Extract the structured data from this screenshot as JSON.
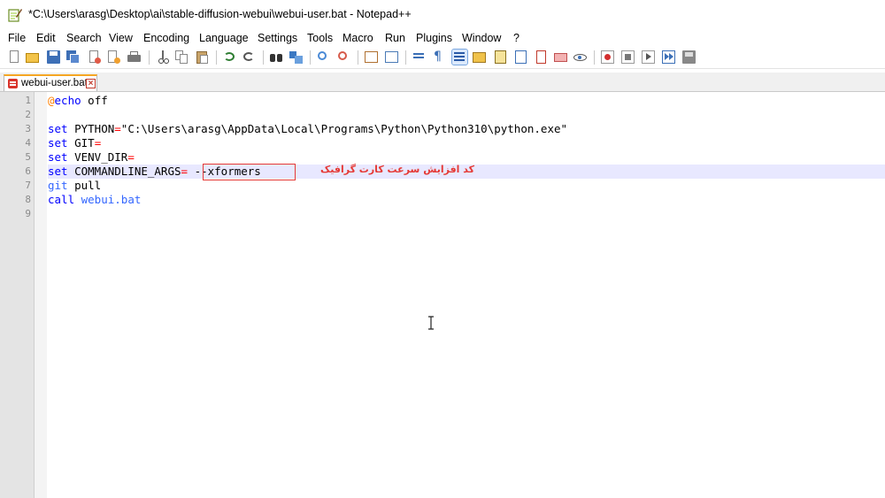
{
  "window": {
    "title": "*C:\\Users\\arasg\\Desktop\\ai\\stable-diffusion-webui\\webui-user.bat - Notepad++",
    "app_icon": "notepad-plus-plus-icon"
  },
  "menu": {
    "items": [
      "File",
      "Edit",
      "Search",
      "View",
      "Encoding",
      "Language",
      "Settings",
      "Tools",
      "Macro",
      "Run",
      "Plugins",
      "Window",
      "?"
    ]
  },
  "toolbar": {
    "icons": [
      "new-file-icon",
      "open-file-icon",
      "save-icon",
      "save-all-icon",
      "close-icon",
      "close-all-icon",
      "print-icon",
      "cut-icon",
      "copy-icon",
      "paste-icon",
      "undo-icon",
      "redo-icon",
      "find-icon",
      "replace-icon",
      "zoom-in-icon",
      "zoom-out-icon",
      "sync-vertical-icon",
      "sync-horizontal-icon",
      "word-wrap-icon",
      "show-all-chars-icon",
      "indent-guide-icon",
      "udl-icon",
      "doc-map-icon",
      "function-list-icon",
      "folder-as-workspace-icon",
      "monitor-icon",
      "record-macro-icon",
      "stop-macro-icon",
      "play-macro-icon",
      "run-macro-multiple-icon",
      "save-macro-icon"
    ]
  },
  "tab": {
    "label": "webui-user.bat",
    "icon": "unsaved-file-icon",
    "close_icon": "close-tab-icon"
  },
  "editor": {
    "line_numbers": [
      "1",
      "2",
      "3",
      "4",
      "5",
      "6",
      "7",
      "8",
      "9"
    ],
    "current_line": 6,
    "lines": {
      "l1_at": "@",
      "l1_kw": "echo",
      "l1_rest": " off",
      "l3_kw": "set",
      "l3_a": " PYTHON",
      "l3_op": "=",
      "l3_b": "\"C:\\Users\\arasg\\AppData\\Local\\Programs\\Python\\Python310\\python.exe\"",
      "l4_kw": "set",
      "l4_a": " GIT",
      "l4_op": "=",
      "l5_kw": "set",
      "l5_a": " VENV_DIR",
      "l5_op": "=",
      "l6_kw": "set",
      "l6_a": " COMMANDLINE_ARGS",
      "l6_op": "=",
      "l6_b": " --xformers",
      "l7_kw": "git",
      "l7_rest": " pull",
      "l8_kw": "call",
      "l8_rest": " webui.bat"
    },
    "annotation": "کد افزایش سرعت کارت گرافیک",
    "highlight_color": "#e53935",
    "cursor_icon": "text-cursor-ibeam-icon"
  }
}
